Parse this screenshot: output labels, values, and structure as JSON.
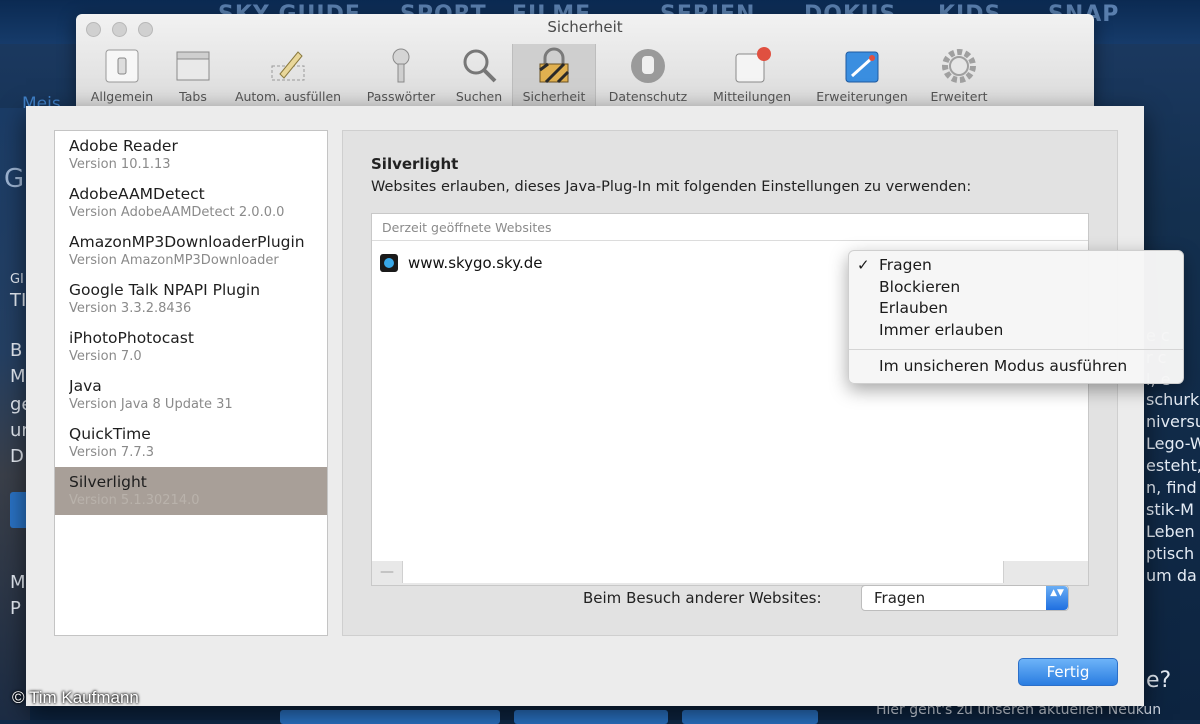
{
  "background": {
    "nav_items": [
      "SKY GUIDE",
      "SPORT",
      "FILME",
      "SERIEN",
      "DOKUS",
      "KIDS",
      "SNAP"
    ],
    "meist_fragment": "Meis",
    "left_fragments": [
      "GE",
      "Gl",
      "TI",
      "B",
      "M",
      "ge",
      "ur",
      "D",
      "M",
      "P"
    ],
    "right_fragments": [
      "e c",
      "r c",
      "l, e",
      "schurk",
      "niversu",
      "Lego-W",
      "esteht,",
      "n, find",
      "stik-M",
      "Leben",
      "ptisch",
      "um da"
    ],
    "question_mark": "e?",
    "bottom_text": "Hier geht's zu unseren aktuellen Neukun"
  },
  "watermark": "© Tim Kaufmann",
  "window": {
    "title": "Sicherheit",
    "toolbar": [
      {
        "label": "Allgemein",
        "icon": "switch-icon"
      },
      {
        "label": "Tabs",
        "icon": "tabs-icon"
      },
      {
        "label": "Autom. ausfüllen",
        "icon": "pencil-icon"
      },
      {
        "label": "Passwörter",
        "icon": "key-icon"
      },
      {
        "label": "Suchen",
        "icon": "magnifier-icon"
      },
      {
        "label": "Sicherheit",
        "icon": "lock-icon",
        "active": true
      },
      {
        "label": "Datenschutz",
        "icon": "hand-icon"
      },
      {
        "label": "Mitteilungen",
        "icon": "notification-icon"
      },
      {
        "label": "Erweiterungen",
        "icon": "puzzle-icon"
      },
      {
        "label": "Erweitert",
        "icon": "gear-icon"
      }
    ]
  },
  "plugins": [
    {
      "name": "Adobe Reader",
      "version": "Version 10.1.13"
    },
    {
      "name": "AdobeAAMDetect",
      "version": "Version AdobeAAMDetect 2.0.0.0"
    },
    {
      "name": "AmazonMP3DownloaderPlugin",
      "version": "Version AmazonMP3Downloader"
    },
    {
      "name": "Google Talk NPAPI Plugin",
      "version": "Version 3.3.2.8436"
    },
    {
      "name": "iPhotoPhotocast",
      "version": "Version 7.0"
    },
    {
      "name": "Java",
      "version": "Version Java 8 Update 31"
    },
    {
      "name": "QuickTime",
      "version": "Version 7.7.3"
    },
    {
      "name": "Silverlight",
      "version": "Version 5.1.30214.0",
      "selected": true
    }
  ],
  "detail": {
    "title": "Silverlight",
    "description": "Websites erlauben, dieses Java-Plug-In mit folgenden Einstellungen zu verwenden:",
    "table_header": "Derzeit geöffnete Websites",
    "site": "www.skygo.sky.de",
    "remove_label": "—",
    "other_sites_label": "Beim Besuch anderer Websites:",
    "other_sites_value": "Fragen",
    "popup_arrows": "▲▼"
  },
  "menu": {
    "checkmark": "✓",
    "items": [
      "Fragen",
      "Blockieren",
      "Erlauben",
      "Immer erlauben"
    ],
    "checked_index": 0,
    "unsafe_item": "Im unsicheren Modus ausführen"
  },
  "done_button": "Fertig",
  "colors": {
    "accent": "#2a7de1",
    "selected_row": "#a89f98"
  }
}
